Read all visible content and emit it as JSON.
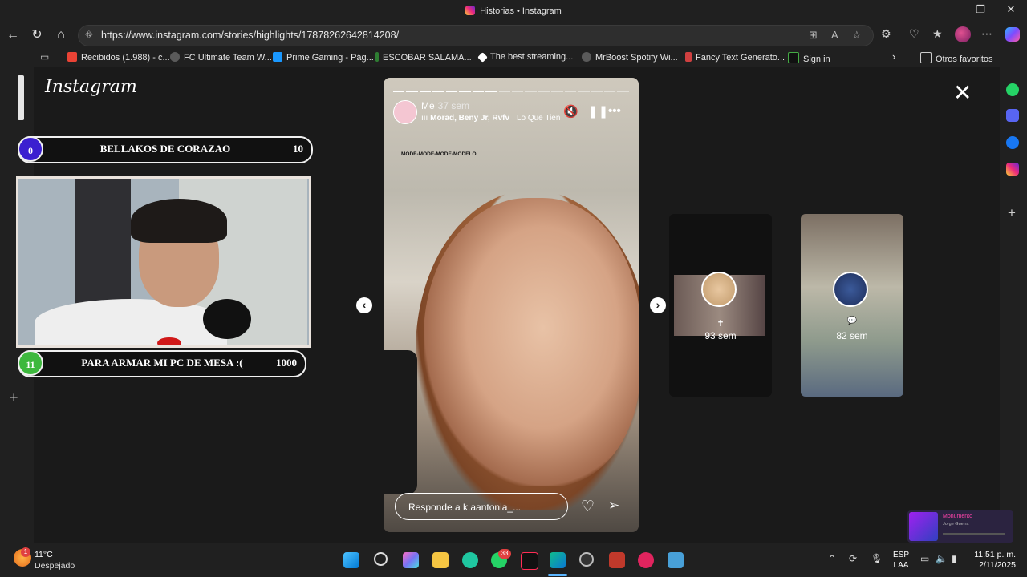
{
  "window": {
    "title": "Historias • Instagram",
    "controls": [
      "—",
      "❐",
      "✕"
    ]
  },
  "browser": {
    "url": "https://www.instagram.com/stories/highlights/17878262642814208/",
    "bookmarks": [
      {
        "label": "Recibidos (1.988) - c...",
        "color": "#ea4335"
      },
      {
        "label": "FC Ultimate Team W...",
        "color": "#5a5a5a"
      },
      {
        "label": "Prime Gaming - Pág...",
        "color": "#1a98ff"
      },
      {
        "label": "ESCOBAR SALAMA...",
        "color": "#2e7d32"
      },
      {
        "label": "The best streaming...",
        "color": "#ffffff"
      },
      {
        "label": "MrBoost Spotify Wi...",
        "color": "#5a5a5a"
      },
      {
        "label": "Fancy Text Generato...",
        "color": "#d04040"
      },
      {
        "label": "Sign in",
        "color": "#111111"
      }
    ],
    "other_favorites": "Otros favoritos"
  },
  "page": {
    "logo": "Instagram",
    "overlay": {
      "goal_top": {
        "left": "0",
        "title": "BELLAKOS DE CORAZAO",
        "right": "10"
      },
      "goal_bottom": {
        "left": "11",
        "title": "PARA ARMAR MI PC DE MESA :(",
        "right": "1000"
      }
    },
    "story": {
      "username": "Me",
      "time": "37 sem",
      "music_artist": "Morad, Beny Jr, Rvfv",
      "music_track": "Lo Que Tien",
      "caption": "MODE-MODE-MODE-MODELO",
      "reply_placeholder": "Responde a k.aantonia_...",
      "progress_total": 18,
      "progress_done": 8
    },
    "previews": [
      {
        "label": "93 sem",
        "symbol": "✝"
      },
      {
        "label": "82 sem",
        "symbol": "💬"
      }
    ]
  },
  "taskbar": {
    "temperature": "11°C",
    "weather": "Despejado",
    "weather_badge": "1",
    "whatsapp_badge": "33",
    "language": "ESP",
    "layout": "LAA",
    "time": "11:51 p. m.",
    "date": "2/11/2025",
    "mini_player_title": "Monumento",
    "mini_player_artist": "Jorge Guerra"
  }
}
